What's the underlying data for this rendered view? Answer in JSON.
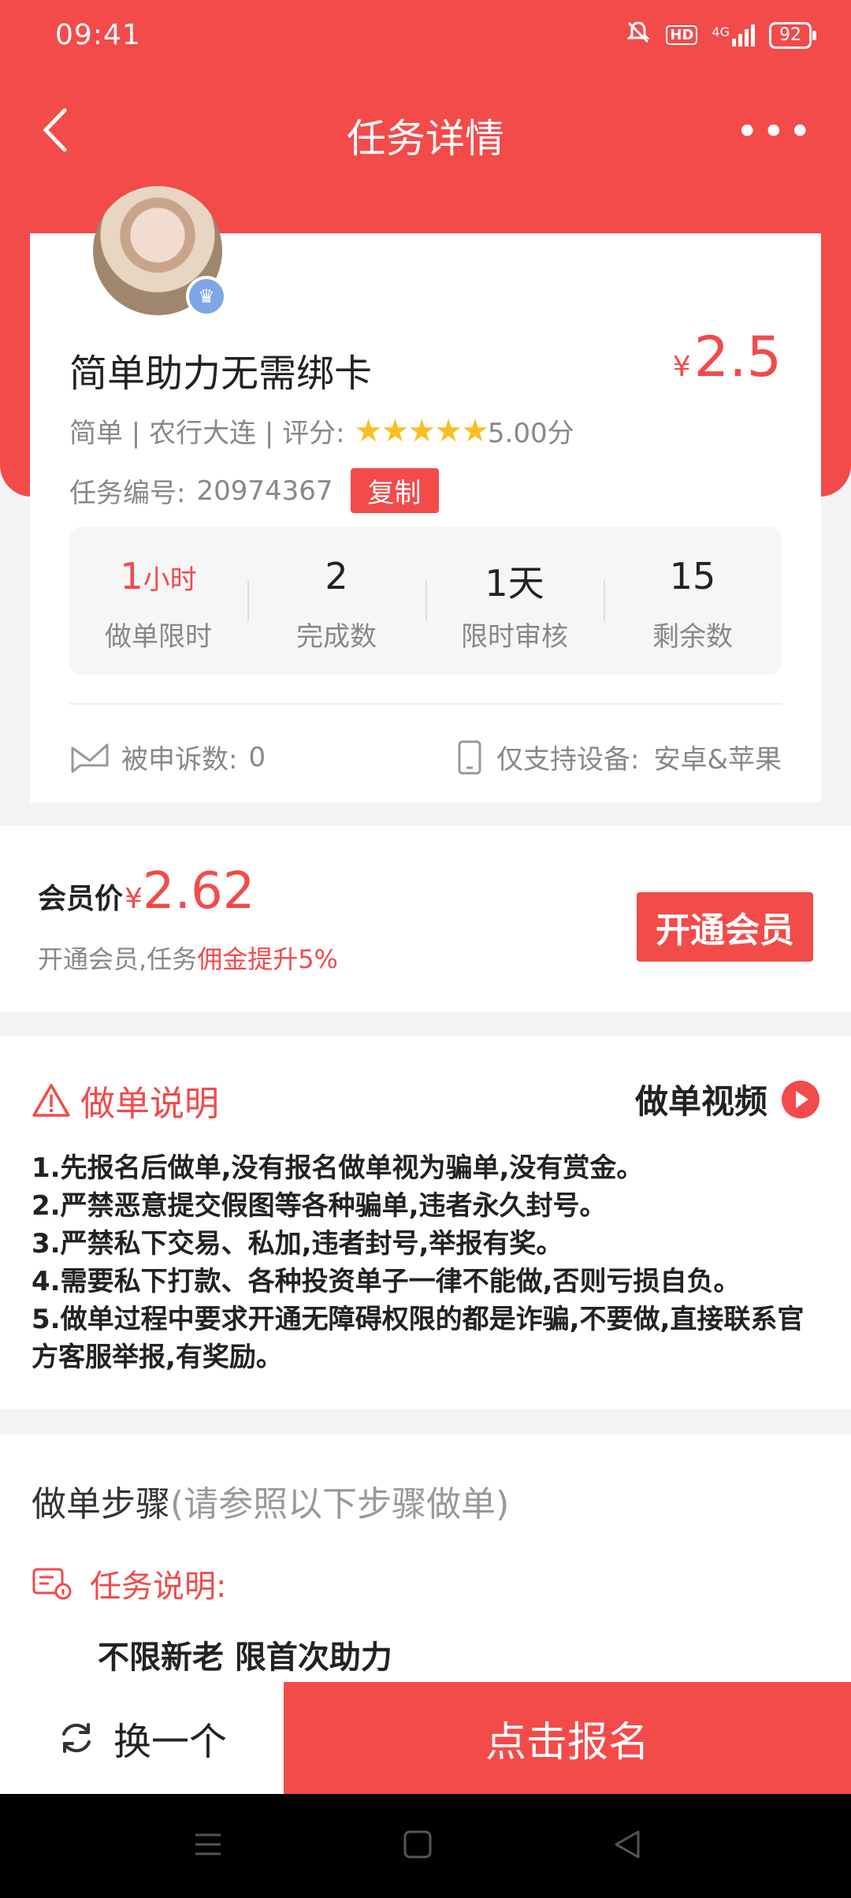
{
  "status": {
    "time": "09:41",
    "battery": "92",
    "hd": "HD",
    "network": "4G"
  },
  "nav": {
    "title": "任务详情",
    "more": "•••"
  },
  "task": {
    "name": "简单助力无需绑卡",
    "currency": "¥",
    "price": "2.5",
    "meta": "简单 | 农行大连 | 评分:",
    "rating_stars": 5,
    "score": "5.00分",
    "task_no_label": "任务编号:",
    "task_no": "20974367",
    "copy_label": "复制"
  },
  "stats": [
    {
      "value": "1",
      "unit": "小时",
      "label": "做单限时",
      "highlight": true
    },
    {
      "value": "2",
      "unit": "",
      "label": "完成数",
      "highlight": false
    },
    {
      "value": "1天",
      "unit": "",
      "label": "限时审核",
      "highlight": false
    },
    {
      "value": "15",
      "unit": "",
      "label": "剩余数",
      "highlight": false
    }
  ],
  "complaints": {
    "label": "被申诉数:",
    "value": "0"
  },
  "device": {
    "label": "仅支持设备:",
    "value": "安卓&苹果"
  },
  "member": {
    "label": "会员价",
    "currency": "¥",
    "price": "2.62",
    "sub_prefix": "开通会员,任务",
    "sub_highlight": "佣金提升5%",
    "button": "开通会员"
  },
  "instructions": {
    "title": "做单说明",
    "video_label": "做单视频",
    "rules": [
      "1.先报名后做单,没有报名做单视为骗单,没有赏金。",
      "2.严禁恶意提交假图等各种骗单,违者永久封号。",
      "3.严禁私下交易、私加,违者封号,举报有奖。",
      "4.需要私下打款、各种投资单子一律不能做,否则亏损自负。",
      "5.做单过程中要求开通无障碍权限的都是诈骗,不要做,直接联系官方客服举报,有奖励。"
    ]
  },
  "steps": {
    "title": "做单步骤",
    "hint": "(请参照以下步骤做单)",
    "desc_label": "任务说明:",
    "desc_text": "不限新老 限首次助力"
  },
  "bottom": {
    "swap_label": "换一个",
    "signup_label": "点击报名"
  },
  "colors": {
    "accent": "#f34a4a",
    "star": "#fbbf24"
  }
}
